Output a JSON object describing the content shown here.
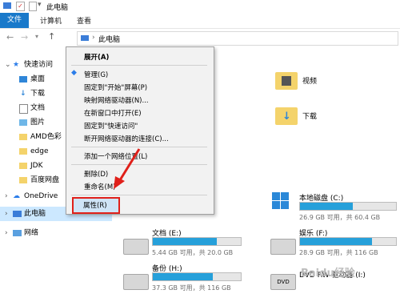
{
  "window": {
    "title": "此电脑"
  },
  "ribbon": {
    "tabs": [
      "文件",
      "计算机",
      "查看"
    ]
  },
  "address": {
    "path": "此电脑"
  },
  "sidebar": {
    "quick_access": "快速访问",
    "items": [
      "桌面",
      "下载",
      "文档",
      "图片",
      "AMD色彩",
      "edge",
      "JDK",
      "百度网盘"
    ],
    "onedrive": "OneDrive",
    "this_pc": "此电脑",
    "network": "网络"
  },
  "content": {
    "folders": [
      "视频",
      "下载"
    ],
    "drives": [
      {
        "name": "本地磁盘 (C:)",
        "size": "26.9 GB 可用，共 60.4 GB",
        "fill": 0.55
      },
      {
        "name": "文档 (E:)",
        "size": "5.44 GB 可用，共 20.0 GB",
        "fill": 0.73
      },
      {
        "name": "娱乐 (F:)",
        "size": "28.9 GB 可用，共 116 GB",
        "fill": 0.75
      },
      {
        "name": "备份 (H:)",
        "size": "37.3 GB 可用，共 116 GB",
        "fill": 0.68
      },
      {
        "name": "DVD RW 驱动器 (I:)",
        "size": ""
      }
    ]
  },
  "menu": {
    "items": [
      "展开(A)",
      "管理(G)",
      "固定到\"开始\"屏幕(P)",
      "映射网络驱动器(N)...",
      "在新窗口中打开(E)",
      "固定到\"快速访问\"",
      "断开网络驱动器的连接(C)...",
      "添加一个网络位置(L)",
      "删除(D)",
      "重命名(M)",
      "属性(R)"
    ]
  },
  "watermark": "Baidu经验"
}
